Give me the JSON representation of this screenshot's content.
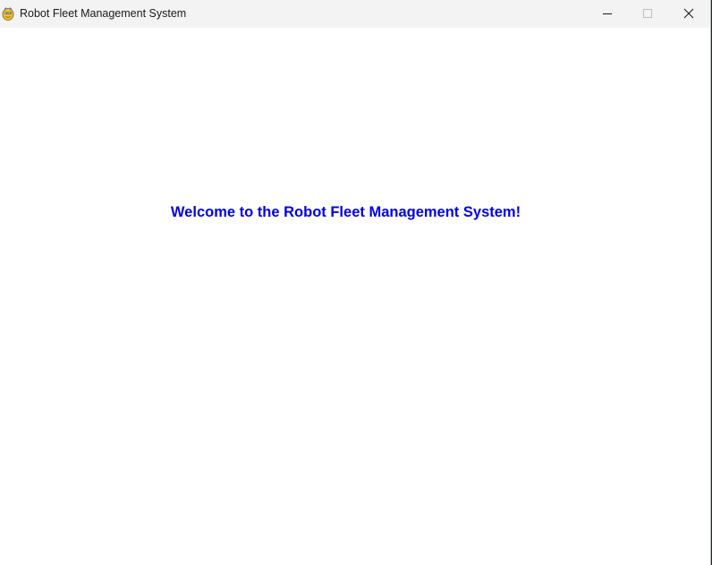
{
  "window": {
    "title": "Robot Fleet Management System",
    "icon": "pygame-snake-icon",
    "controls": {
      "minimize_icon": "minimize-icon",
      "maximize_icon": "maximize-icon",
      "close_icon": "close-icon"
    }
  },
  "main": {
    "welcome_text": "Welcome to the Robot Fleet Management System!",
    "welcome_color": "#0000dd"
  },
  "colors": {
    "titlebar": "#f3f3f3",
    "background": "#ffffff"
  }
}
